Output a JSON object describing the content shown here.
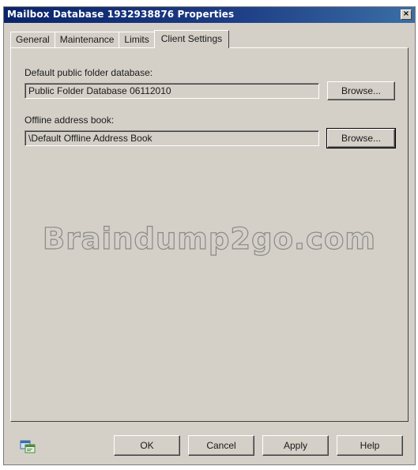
{
  "window": {
    "title": "Mailbox Database 1932938876 Properties",
    "close_glyph": "×"
  },
  "tabs": [
    {
      "label": "General",
      "active": false
    },
    {
      "label": "Maintenance",
      "active": false
    },
    {
      "label": "Limits",
      "active": false
    },
    {
      "label": "Client Settings",
      "active": true
    }
  ],
  "client_settings": {
    "public_folder_label": "Default public folder database:",
    "public_folder_value": "Public Folder Database 06112010",
    "public_folder_browse": "Browse...",
    "oab_label": "Offline address book:",
    "oab_value": "\\Default Offline Address Book",
    "oab_browse": "Browse..."
  },
  "watermark": "Braindump2go.com",
  "footer": {
    "help_icon": "help-icon",
    "ok": "OK",
    "cancel": "Cancel",
    "apply": "Apply",
    "help": "Help"
  },
  "colors": {
    "titlebar_start": "#0a246a",
    "titlebar_end": "#3a6ea5",
    "face": "#d4d0c8"
  }
}
